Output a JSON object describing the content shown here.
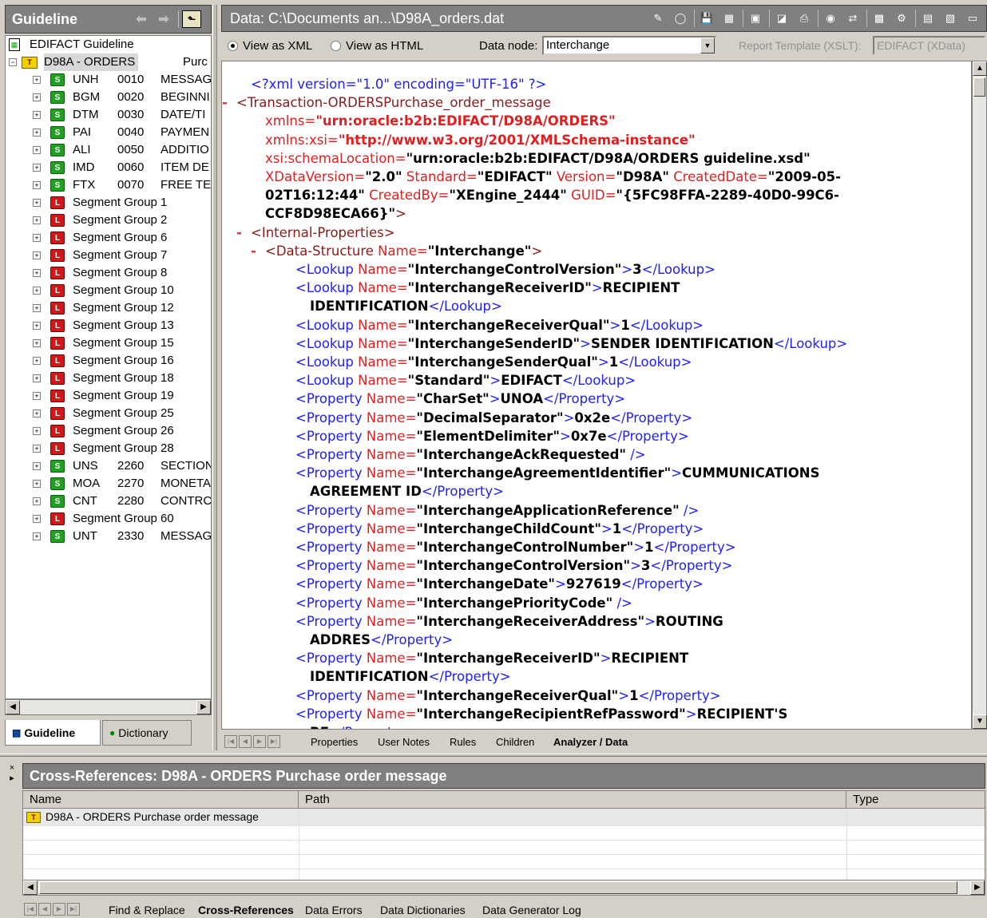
{
  "left_panel": {
    "title": "Guideline",
    "root_label": "EDIFACT Guideline",
    "message_label": "D98A - ORDERS",
    "message_desc": "Purc",
    "items": [
      {
        "kind": "S",
        "code": "UNH",
        "num": "0010",
        "desc": "MESSAG"
      },
      {
        "kind": "S",
        "code": "BGM",
        "num": "0020",
        "desc": "BEGINNI"
      },
      {
        "kind": "S",
        "code": "DTM",
        "num": "0030",
        "desc": "DATE/TI"
      },
      {
        "kind": "S",
        "code": "PAI",
        "num": "0040",
        "desc": "PAYMEN"
      },
      {
        "kind": "S",
        "code": "ALI",
        "num": "0050",
        "desc": "ADDITIO"
      },
      {
        "kind": "S",
        "code": "IMD",
        "num": "0060",
        "desc": "ITEM DE"
      },
      {
        "kind": "S",
        "code": "FTX",
        "num": "0070",
        "desc": "FREE TE"
      },
      {
        "kind": "G",
        "label": "Segment Group 1"
      },
      {
        "kind": "G",
        "label": "Segment Group 2"
      },
      {
        "kind": "G",
        "label": "Segment Group 6"
      },
      {
        "kind": "G",
        "label": "Segment Group 7"
      },
      {
        "kind": "G",
        "label": "Segment Group 8"
      },
      {
        "kind": "G",
        "label": "Segment Group 10"
      },
      {
        "kind": "G",
        "label": "Segment Group 12"
      },
      {
        "kind": "G",
        "label": "Segment Group 13"
      },
      {
        "kind": "G",
        "label": "Segment Group 15"
      },
      {
        "kind": "G",
        "label": "Segment Group 16"
      },
      {
        "kind": "G",
        "label": "Segment Group 18"
      },
      {
        "kind": "G",
        "label": "Segment Group 19"
      },
      {
        "kind": "G",
        "label": "Segment Group 25"
      },
      {
        "kind": "G",
        "label": "Segment Group 26"
      },
      {
        "kind": "G",
        "label": "Segment Group 28"
      },
      {
        "kind": "S",
        "code": "UNS",
        "num": "2260",
        "desc": "SECTION"
      },
      {
        "kind": "S",
        "code": "MOA",
        "num": "2270",
        "desc": "MONETA"
      },
      {
        "kind": "S",
        "code": "CNT",
        "num": "2280",
        "desc": "CONTRC"
      },
      {
        "kind": "G",
        "label": "Segment Group 60"
      },
      {
        "kind": "S",
        "code": "UNT",
        "num": "2330",
        "desc": "MESSAG"
      }
    ],
    "tabs": {
      "guideline": "Guideline",
      "dictionary": "Dictionary"
    }
  },
  "data_panel": {
    "title": "Data: C:\\Documents an...\\D98A_orders.dat",
    "view_xml": "View as XML",
    "view_html": "View as HTML",
    "data_node_label": "Data node:",
    "data_node_value": "Interchange",
    "report_template_label": "Report Template (XSLT):",
    "report_template_value": "EDIFACT (XData)",
    "tabs": [
      "Properties",
      "User Notes",
      "Rules",
      "Children",
      "Analyzer / Data"
    ]
  },
  "xml_lines": [
    {
      "s": [
        "bl",
        "<?xml version=\"1.0\" encoding=\"UTF-16\" ?>"
      ]
    },
    {
      "m": "-",
      "s": [
        "tg",
        "<Transaction-ORDERSPurchase_order_message"
      ]
    },
    {
      "s": [
        "at",
        "xmlns=",
        "avr",
        "\"urn:oracle:b2b:EDIFACT/D98A/ORDERS\""
      ]
    },
    {
      "s": [
        "at",
        "xmlns:xsi=",
        "avr",
        "\"http://www.w3.org/2001/XMLSchema-instance\""
      ]
    },
    {
      "s": [
        "at",
        "xsi:schemaLocation=",
        "av",
        "\"urn:oracle:b2b:EDIFACT/D98A/ORDERS guideline.xsd\""
      ]
    },
    {
      "s": [
        "at",
        "XDataVersion=",
        "av",
        "\"2.0\"",
        "at",
        " Standard=",
        "av",
        "\"EDIFACT\"",
        "at",
        " Version=",
        "av",
        "\"D98A\"",
        "at",
        " CreatedDate=",
        "av",
        "\"2009-05-"
      ]
    },
    {
      "s": [
        "av",
        "02T16:12:44\"",
        "at",
        " CreatedBy=",
        "av",
        "\"XEngine_2444\"",
        "at",
        " GUID=",
        "av",
        "\"{5FC98FFA-2289-40D0-99C6-"
      ]
    },
    {
      "s": [
        "av",
        "CCF8D98ECA66}\"",
        "tg",
        ">"
      ]
    },
    {
      "m": "-",
      "s": [
        "tg",
        "<Internal-Properties>"
      ]
    },
    {
      "m": "-",
      "s": [
        "tg",
        "<Data-Structure",
        "at",
        " Name=",
        "av",
        "\"Interchange\"",
        "tg",
        ">"
      ]
    },
    {
      "s": [
        "bl",
        "<Lookup",
        "at",
        " Name=",
        "av",
        "\"InterchangeControlVersion\"",
        "bl",
        ">",
        "tt",
        "3",
        "bl",
        "</Lookup>"
      ]
    },
    {
      "s": [
        "bl",
        "<Lookup",
        "at",
        " Name=",
        "av",
        "\"InterchangeReceiverID\"",
        "bl",
        ">",
        "tt",
        "RECIPIENT"
      ]
    },
    {
      "s": [
        "tt",
        "IDENTIFICATION",
        "bl",
        "</Lookup>"
      ]
    },
    {
      "s": [
        "bl",
        "<Lookup",
        "at",
        " Name=",
        "av",
        "\"InterchangeReceiverQual\"",
        "bl",
        ">",
        "tt",
        "1",
        "bl",
        "</Lookup>"
      ]
    },
    {
      "s": [
        "bl",
        "<Lookup",
        "at",
        " Name=",
        "av",
        "\"InterchangeSenderID\"",
        "bl",
        ">",
        "tt",
        "SENDER IDENTIFICATION",
        "bl",
        "</Lookup>"
      ]
    },
    {
      "s": [
        "bl",
        "<Lookup",
        "at",
        " Name=",
        "av",
        "\"InterchangeSenderQual\"",
        "bl",
        ">",
        "tt",
        "1",
        "bl",
        "</Lookup>"
      ]
    },
    {
      "s": [
        "bl",
        "<Lookup",
        "at",
        " Name=",
        "av",
        "\"Standard\"",
        "bl",
        ">",
        "tt",
        "EDIFACT",
        "bl",
        "</Lookup>"
      ]
    },
    {
      "s": [
        "bl",
        "<Property",
        "at",
        " Name=",
        "av",
        "\"CharSet\"",
        "bl",
        ">",
        "tt",
        "UNOA",
        "bl",
        "</Property>"
      ]
    },
    {
      "s": [
        "bl",
        "<Property",
        "at",
        " Name=",
        "av",
        "\"DecimalSeparator\"",
        "bl",
        ">",
        "tt",
        "0x2e",
        "bl",
        "</Property>"
      ]
    },
    {
      "s": [
        "bl",
        "<Property",
        "at",
        " Name=",
        "av",
        "\"ElementDelimiter\"",
        "bl",
        ">",
        "tt",
        "0x7e",
        "bl",
        "</Property>"
      ]
    },
    {
      "s": [
        "bl",
        "<Property",
        "at",
        " Name=",
        "av",
        "\"InterchangeAckRequested\"",
        "bl",
        " />"
      ]
    },
    {
      "s": [
        "bl",
        "<Property",
        "at",
        " Name=",
        "av",
        "\"InterchangeAgreementIdentifier\"",
        "bl",
        ">",
        "tt",
        "CUMMUNICATIONS"
      ]
    },
    {
      "s": [
        "tt",
        "AGREEMENT ID",
        "bl",
        "</Property>"
      ]
    },
    {
      "s": [
        "bl",
        "<Property",
        "at",
        " Name=",
        "av",
        "\"InterchangeApplicationReference\"",
        "bl",
        " />"
      ]
    },
    {
      "s": [
        "bl",
        "<Property",
        "at",
        " Name=",
        "av",
        "\"InterchangeChildCount\"",
        "bl",
        ">",
        "tt",
        "1",
        "bl",
        "</Property>"
      ]
    },
    {
      "s": [
        "bl",
        "<Property",
        "at",
        " Name=",
        "av",
        "\"InterchangeControlNumber\"",
        "bl",
        ">",
        "tt",
        "1",
        "bl",
        "</Property>"
      ]
    },
    {
      "s": [
        "bl",
        "<Property",
        "at",
        " Name=",
        "av",
        "\"InterchangeControlVersion\"",
        "bl",
        ">",
        "tt",
        "3",
        "bl",
        "</Property>"
      ]
    },
    {
      "s": [
        "bl",
        "<Property",
        "at",
        " Name=",
        "av",
        "\"InterchangeDate\"",
        "bl",
        ">",
        "tt",
        "927619",
        "bl",
        "</Property>"
      ]
    },
    {
      "s": [
        "bl",
        "<Property",
        "at",
        " Name=",
        "av",
        "\"InterchangePriorityCode\"",
        "bl",
        " />"
      ]
    },
    {
      "s": [
        "bl",
        "<Property",
        "at",
        " Name=",
        "av",
        "\"InterchangeReceiverAddress\"",
        "bl",
        ">",
        "tt",
        "ROUTING"
      ]
    },
    {
      "s": [
        "tt",
        "ADDRES",
        "bl",
        "</Property>"
      ]
    },
    {
      "s": [
        "bl",
        "<Property",
        "at",
        " Name=",
        "av",
        "\"InterchangeReceiverID\"",
        "bl",
        ">",
        "tt",
        "RECIPIENT"
      ]
    },
    {
      "s": [
        "tt",
        "IDENTIFICATION",
        "bl",
        "</Property>"
      ]
    },
    {
      "s": [
        "bl",
        "<Property",
        "at",
        " Name=",
        "av",
        "\"InterchangeReceiverQual\"",
        "bl",
        ">",
        "tt",
        "1",
        "bl",
        "</Property>"
      ]
    },
    {
      "s": [
        "bl",
        "<Property",
        "at",
        " Name=",
        "av",
        "\"InterchangeRecipientRefPassword\"",
        "bl",
        ">",
        "tt",
        "RECIPIENT'S"
      ]
    },
    {
      "s": [
        "tt",
        "RE",
        "bl",
        "</Property>"
      ]
    }
  ],
  "cross_refs": {
    "title": "Cross-References: D98A - ORDERS Purchase order message",
    "columns": [
      "Name",
      "Path",
      "Type"
    ],
    "rows": [
      {
        "name": "D98A - ORDERS Purchase order message",
        "path": "",
        "type": ""
      }
    ],
    "tabs": [
      "Find & Replace",
      "Cross-References",
      "Data Errors",
      "Data Dictionaries",
      "Data Generator Log"
    ]
  }
}
